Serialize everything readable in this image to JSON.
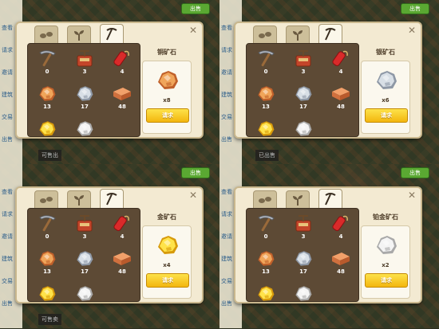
{
  "tabs": [
    {
      "icon": "footprints-icon"
    },
    {
      "icon": "sprout-icon"
    },
    {
      "icon": "pickaxe-icon"
    }
  ],
  "grid_items": [
    {
      "name": "pickaxe",
      "icon": "pickaxe-icon",
      "count": "0"
    },
    {
      "name": "detonator",
      "icon": "detonator-icon",
      "count": "3"
    },
    {
      "name": "dynamite",
      "icon": "dynamite-icon",
      "count": "4"
    },
    {
      "name": "copper-ore",
      "icon": "copper-ore-icon",
      "count": "13"
    },
    {
      "name": "silver-ore",
      "icon": "silver-ore-icon",
      "count": "17"
    },
    {
      "name": "brick",
      "icon": "brick-icon",
      "count": "48"
    },
    {
      "name": "gold-ore",
      "icon": "gold-ore-icon",
      "count": ""
    },
    {
      "name": "platinum-ore",
      "icon": "platinum-ore-icon",
      "count": ""
    }
  ],
  "panels": [
    {
      "title": "铜矿石",
      "qty": "x8",
      "button": "请求",
      "ore": "copper",
      "colors": {
        "light": "#f0a55a",
        "dark": "#c0602a"
      }
    },
    {
      "title": "银矿石",
      "qty": "x6",
      "button": "请求",
      "ore": "silver",
      "colors": {
        "light": "#d8dfe6",
        "dark": "#8e98a6"
      }
    },
    {
      "title": "金矿石",
      "qty": "x4",
      "button": "请求",
      "ore": "gold",
      "colors": {
        "light": "#ffe34a",
        "dark": "#d79a0a"
      }
    },
    {
      "title": "铂金矿石",
      "qty": "x2",
      "button": "请求",
      "ore": "platinum",
      "colors": {
        "light": "#f4f4f4",
        "dark": "#a9a9a9"
      }
    }
  ],
  "background": {
    "badge": "出售",
    "left_labels": [
      "查看",
      "请求",
      "邀请",
      "建筑",
      "交易",
      "出售"
    ],
    "dark_labels": [
      "可售出",
      "已出售",
      "可售卖"
    ]
  }
}
